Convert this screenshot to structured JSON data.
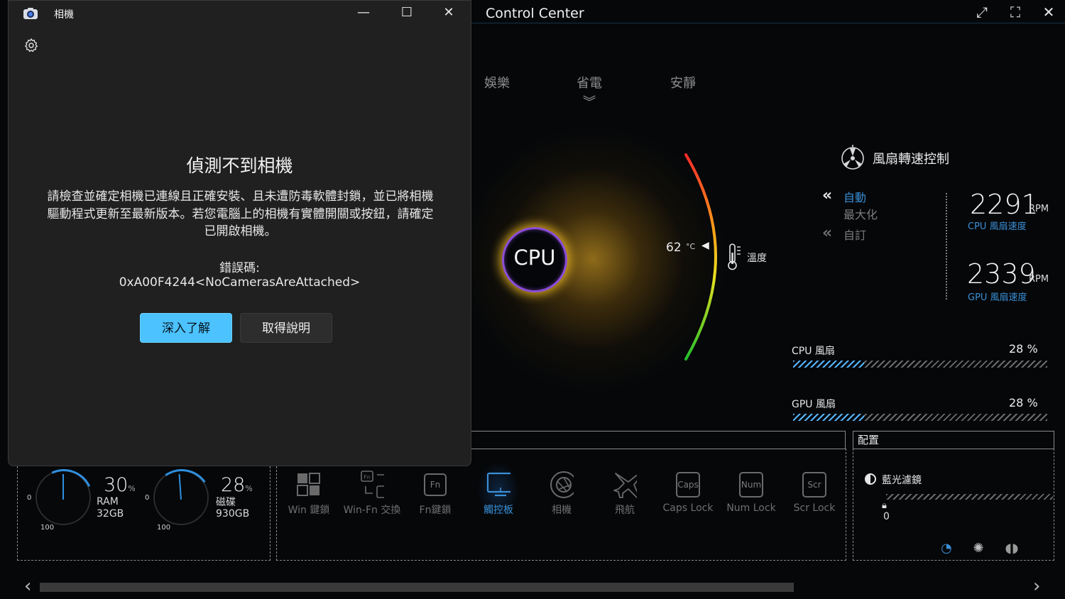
{
  "control_center": {
    "title": "Control Center",
    "modes": [
      "娛樂",
      "省電",
      "安靜"
    ],
    "selected_mode": "省電",
    "cpu_label": "CPU",
    "temperature": {
      "value": "62",
      "unit": "°C",
      "label": "溫度"
    },
    "fan_control": {
      "title": "風扇轉速控制",
      "options": [
        {
          "label": "自動",
          "selected": true
        },
        {
          "label": "最大化",
          "selected": false
        },
        {
          "label": "自訂",
          "selected": false
        }
      ],
      "cpu_rpm": {
        "value": "2291",
        "unit": "RPM",
        "label": "CPU 風扇速度"
      },
      "gpu_rpm": {
        "value": "2339",
        "unit": "RPM",
        "label": "GPU 風扇速度"
      },
      "bars": [
        {
          "label": "CPU 風扇",
          "percent_text": "28 %",
          "percent": 28
        },
        {
          "label": "GPU 風扇",
          "percent_text": "28 %",
          "percent": 28
        }
      ]
    },
    "gauges": [
      {
        "percent": "30",
        "unit": "%",
        "name": "RAM",
        "capacity": "32GB",
        "min": "0",
        "max": "100"
      },
      {
        "percent": "28",
        "unit": "%",
        "name": "磁碟",
        "capacity": "930GB",
        "min": "0",
        "max": "100"
      }
    ],
    "tools": [
      {
        "label": "Win 鍵鎖",
        "icon": "windows-icon"
      },
      {
        "label": "Win-Fn 交換",
        "icon": "swap-icon",
        "cap": "Fn"
      },
      {
        "label": "Fn鍵鎖",
        "icon": "fn-key-icon",
        "cap": "Fn"
      },
      {
        "label": "觸控板",
        "icon": "touchpad-icon",
        "active": true
      },
      {
        "label": "相機",
        "icon": "camera-shutter-icon"
      },
      {
        "label": "飛航",
        "icon": "airplane-icon"
      },
      {
        "label": "Caps Lock",
        "icon": "caps-key-icon",
        "cap": "Caps"
      },
      {
        "label": "Num Lock",
        "icon": "num-key-icon",
        "cap": "Num"
      },
      {
        "label": "Scr Lock",
        "icon": "scr-key-icon",
        "cap": "Scr"
      }
    ],
    "config": {
      "title": "配置",
      "blue_light_label": "藍光濾鏡",
      "blue_light_value": "0"
    },
    "colors": {
      "accent": "#3b8fd6",
      "fan_fill": "#55b4ff"
    }
  },
  "camera": {
    "title": "相機",
    "heading": "偵測不到相機",
    "message": "請檢查並確定相機已連線且正確安裝、且未遭防毒軟體封鎖，並已將相機驅動程式更新至最新版本。若您電腦上的相機有實體開關或按鈕，請確定已開啟相機。",
    "error_label": "錯誤碼:",
    "error_code": "0xA00F4244<NoCamerasAreAttached>",
    "primary_button": "深入了解",
    "secondary_button": "取得說明",
    "colors": {
      "primary": "#4cc2ff",
      "background": "#202020"
    }
  }
}
